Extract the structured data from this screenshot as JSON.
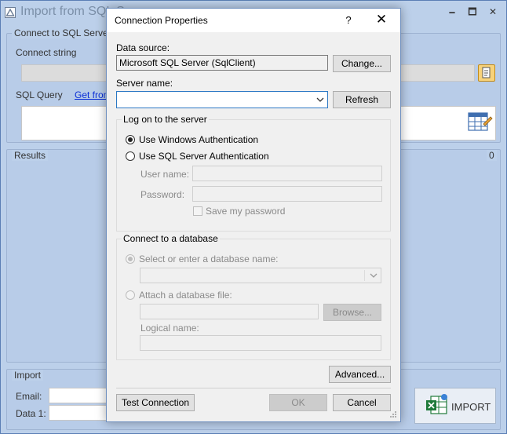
{
  "main_window": {
    "title": "Import from SQL Server",
    "controls": {
      "minimize": "🗕",
      "maximize": "🗖",
      "close": "✕"
    },
    "connect_group": {
      "title": "Connect to SQL Server",
      "connect_string_label": "Connect string",
      "connect_string_value": "",
      "sql_query_label": "SQL Query",
      "get_from_link": "Get from",
      "sql_query_value": ""
    },
    "results_group": {
      "title": "Results",
      "count": "0"
    },
    "import_group": {
      "title": "Import",
      "email_label": "Email:",
      "data1_label": "Data 1:",
      "import_button": "IMPORT"
    }
  },
  "dialog": {
    "title": "Connection Properties",
    "help": "?",
    "close": "✕",
    "data_source_label": "Data source:",
    "data_source_value": "Microsoft SQL Server (SqlClient)",
    "change_button": "Change...",
    "server_name_label": "Server name:",
    "server_name_value": "",
    "refresh_button": "Refresh",
    "logon": {
      "title": "Log on to the server",
      "windows_auth": "Use Windows Authentication",
      "sql_auth": "Use SQL Server Authentication",
      "selected": "windows_auth",
      "user_name_label": "User name:",
      "password_label": "Password:",
      "save_password_label": "Save my password"
    },
    "database": {
      "title": "Connect to a database",
      "select_label": "Select or enter a database name:",
      "attach_label": "Attach a database file:",
      "browse_button": "Browse...",
      "logical_name_label": "Logical name:"
    },
    "advanced_button": "Advanced...",
    "test_connection_button": "Test Connection",
    "ok_button": "OK",
    "cancel_button": "Cancel"
  },
  "colors": {
    "window_bg": "#bcd0ea",
    "link": "#0b2fd6",
    "focus_border": "#2b78c4"
  }
}
